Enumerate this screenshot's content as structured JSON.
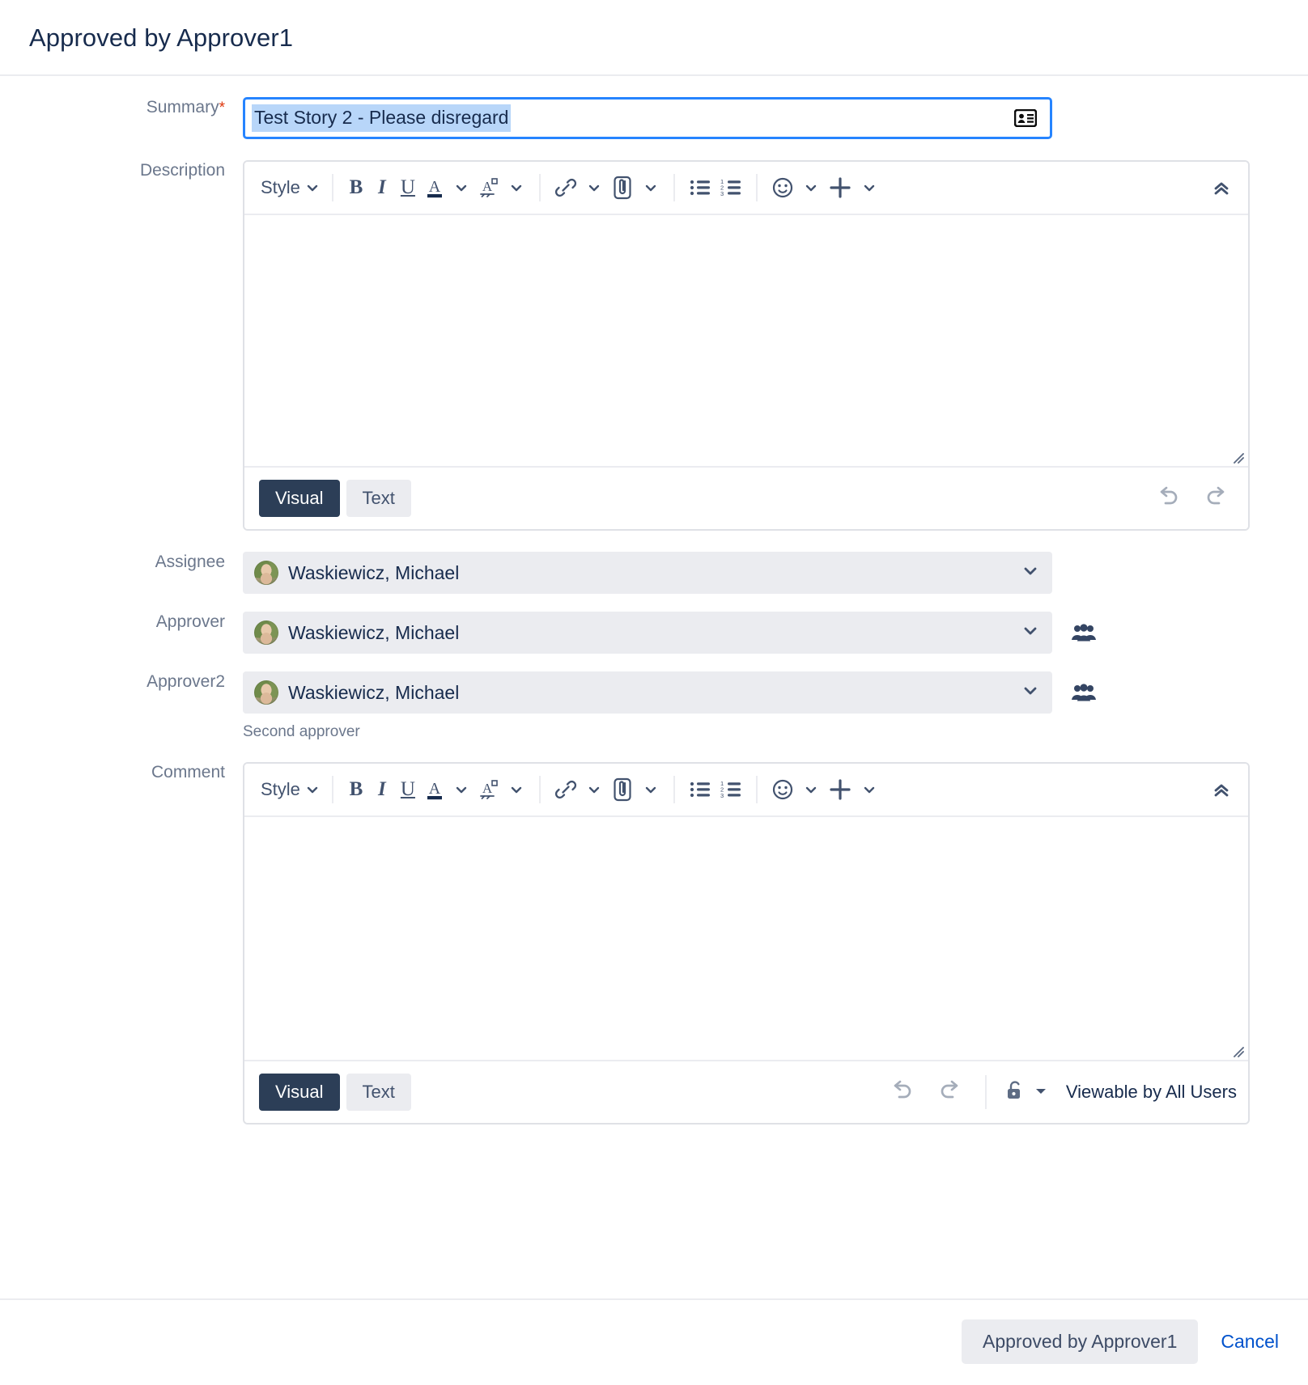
{
  "dialog": {
    "title": "Approved by Approver1"
  },
  "fields": {
    "summary": {
      "label": "Summary",
      "required_marker": "*",
      "value": "Test Story 2 - Please disregard",
      "picker_icon": "contact-card-icon"
    },
    "description": {
      "label": "Description",
      "value": "",
      "placeholder": ""
    },
    "assignee": {
      "label": "Assignee",
      "value": "Waskiewicz, Michael"
    },
    "approver": {
      "label": "Approver",
      "value": "Waskiewicz, Michael"
    },
    "approver2": {
      "label": "Approver2",
      "value": "Waskiewicz, Michael",
      "helper": "Second approver"
    },
    "comment": {
      "label": "Comment",
      "value": "",
      "placeholder": ""
    }
  },
  "toolbar": {
    "style_label": "Style",
    "bold_label": "B",
    "italic_label": "I",
    "underline_label": "U",
    "text_color_label": "A",
    "buttons": [
      "style-dropdown",
      "bold",
      "italic",
      "underline",
      "text-color",
      "text-highlight",
      "link",
      "attachment",
      "bullet-list",
      "numbered-list",
      "emoji",
      "insert-more",
      "collapse-toolbar"
    ]
  },
  "editor_footer": {
    "visual_tab": "Visual",
    "text_tab": "Text",
    "active_tab": "Visual",
    "undo_label": "undo",
    "redo_label": "redo"
  },
  "comment_visibility": {
    "lock_icon": "unlocked-padlock-icon",
    "label": "Viewable by All Users"
  },
  "footer": {
    "submit_label": "Approved by Approver1",
    "cancel_label": "Cancel"
  },
  "colors": {
    "accent_blue": "#2684ff",
    "link_blue": "#0052cc",
    "label_gray": "#6b778c",
    "text_dark": "#172b4d",
    "field_bg": "#ebecf0",
    "tab_active_bg": "#2c3e57",
    "selection_bg": "#b8d6f9",
    "required_red": "#de350b"
  }
}
